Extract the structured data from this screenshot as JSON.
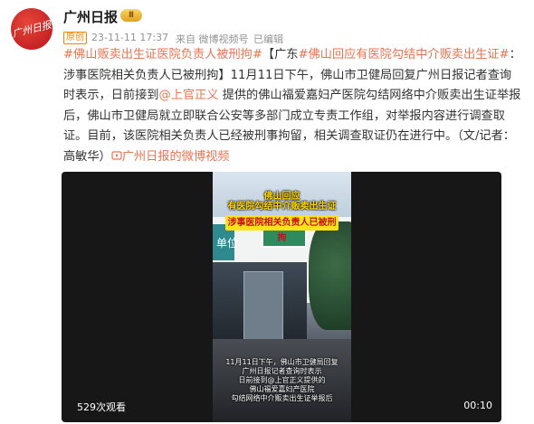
{
  "user": {
    "name": "广州日报",
    "avatar_text": "广州日报",
    "badge": "Ⅱ"
  },
  "meta": {
    "tag": "原创",
    "time": "23-11-11 17:37",
    "source": "来自 微博视频号",
    "edited": "已编辑"
  },
  "post": {
    "line1_prefix": "#佛山贩卖出生证医院负责人被刑拘#",
    "line1_mid": "【广东",
    "line1_topic2": "#佛山回应有医院勾结中介贩卖出生证#",
    "line1_rest": "：涉事医院相关负责人已被刑拘】11月11日下午，佛山市卫健局回复广州日报记者查询时表示，日前接到",
    "mention": "@上官正义",
    "line2_rest": " 提供的佛山福爱嘉妇产医院勾结网络中介贩卖出生证举报后，佛山市卫健局就立即联合公安等多部门成立专责工作组，对举报内容进行调查取证。目前，该医院相关负责人已经被刑事拘留，相关调查取证仍在进行中。（文/记者：高敏华）",
    "link": "广州日报的微博视频"
  },
  "video": {
    "caption_line1": "佛山回应",
    "caption_line2": "有医院勾结中介贩卖出生证",
    "caption_highlight": "涉事医院相关负责人已被刑拘",
    "sign_text": "单位",
    "subtitle": [
      "11月11日下午，佛山市卫健局回复",
      "广州日报记者查询时表示",
      "日前接到@上官正义提供的",
      "佛山福爱嘉妇产医院",
      "勾结网络中介贩卖出生证举报后"
    ],
    "views": "529次观看",
    "duration": "00:10"
  },
  "colors": {
    "link": "#eb7350",
    "origin": "#ff8200",
    "meta": "#939393"
  }
}
